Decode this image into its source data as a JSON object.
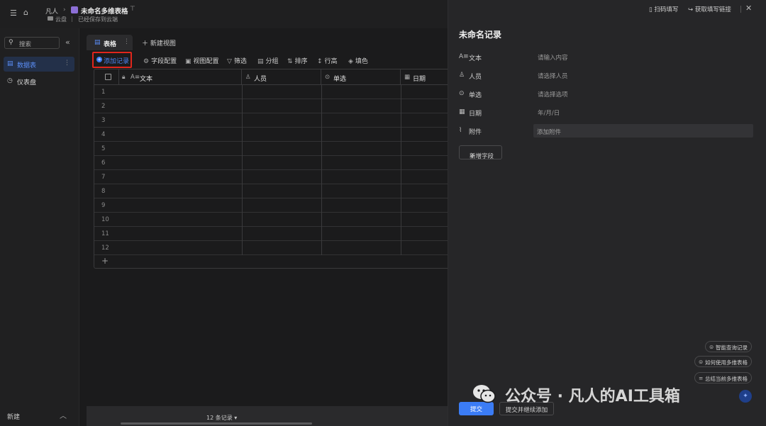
{
  "header": {
    "breadcrumb_user": "凡人",
    "doc_title": "未命名多维表格",
    "location": "云盘",
    "save_status": "已经保存到云端"
  },
  "sidebar": {
    "search_placeholder": "搜索",
    "items": [
      {
        "label": "数据表",
        "icon": "table-icon",
        "active": true
      },
      {
        "label": "仪表盘",
        "icon": "dashboard-icon",
        "active": false
      }
    ],
    "new_label": "新建"
  },
  "main": {
    "tab_label": "表格",
    "new_view": "新建视图",
    "toolbar": {
      "add_record": "添加记录",
      "field_config": "字段配置",
      "view_config": "视图配置",
      "filter": "筛选",
      "group": "分组",
      "sort": "排序",
      "row_height": "行高",
      "fill_color": "填色"
    },
    "columns": [
      {
        "label": "文本",
        "icon": "text-field-icon"
      },
      {
        "label": "人员",
        "icon": "person-icon"
      },
      {
        "label": "单选",
        "icon": "single-select-icon"
      },
      {
        "label": "日期",
        "icon": "calendar-icon"
      }
    ],
    "rows": [
      "1",
      "2",
      "3",
      "4",
      "5",
      "6",
      "7",
      "8",
      "9",
      "10",
      "11",
      "12"
    ],
    "record_count": "12 条记录"
  },
  "panel": {
    "scan_fill": "扫码填写",
    "get_link": "获取填写链接",
    "title": "未命名记录",
    "fields": [
      {
        "label": "文本",
        "placeholder": "请输入内容",
        "icon": "text-field-icon"
      },
      {
        "label": "人员",
        "placeholder": "请选择人员",
        "icon": "person-icon"
      },
      {
        "label": "单选",
        "placeholder": "请选择选项",
        "icon": "single-select-icon"
      },
      {
        "label": "日期",
        "placeholder": "年/月/日",
        "icon": "calendar-icon"
      },
      {
        "label": "附件",
        "placeholder": "添加附件",
        "icon": "paperclip-icon"
      }
    ],
    "add_field": "新增字段",
    "ai_pills": [
      "智能查询记录",
      "如何使用多维表格",
      "总结当前多维表格"
    ],
    "submit": "提交",
    "submit_continue": "提交并继续添加"
  },
  "watermark": {
    "text": "公众号 · 凡人的AI工具箱"
  },
  "colors": {
    "accent": "#3b7cf5",
    "highlight_border": "#e0261c",
    "background": "#1b1b1c",
    "panel_bg": "#262628"
  }
}
